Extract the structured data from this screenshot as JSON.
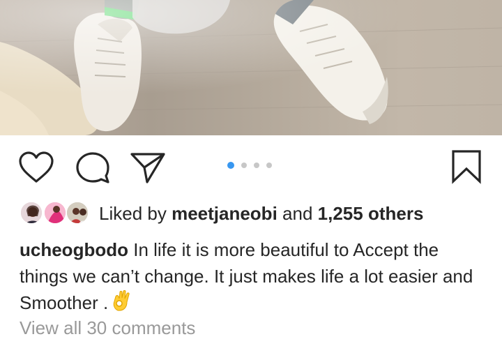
{
  "post": {
    "image_alt": "photo-of-white-sneakers",
    "carousel": {
      "count": 4,
      "active_index": 0
    },
    "actions": {
      "like_icon": "heart-icon",
      "comment_icon": "comment-bubble-icon",
      "share_icon": "paper-plane-icon",
      "save_icon": "bookmark-icon"
    },
    "likes": {
      "prefix": "Liked by",
      "user": "meetjaneobi",
      "conjunction": "and",
      "others": "1,255 others"
    },
    "caption": {
      "username": "ucheogbodo",
      "text": "In life it is more beautiful to Accept the things we can’t change. It just makes life a lot easier and Smoother .",
      "emoji": "ok-hand-emoji"
    },
    "comments_link": "View all 30 comments"
  },
  "colors": {
    "text": "#262626",
    "muted": "#999999",
    "active_dot": "#3897f0",
    "inactive_dot": "#c7c7c7"
  }
}
